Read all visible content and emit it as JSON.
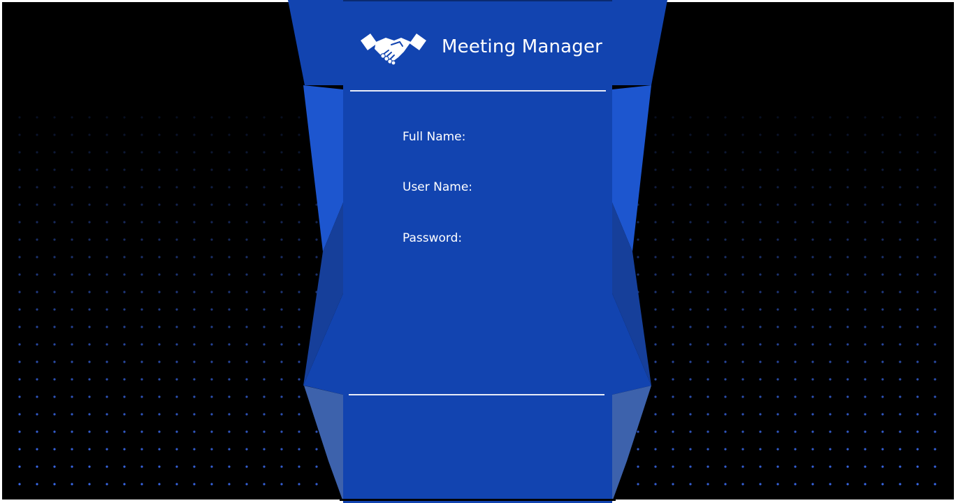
{
  "app": {
    "title": "Meeting Manager",
    "logo_icon": "handshake-icon"
  },
  "form": {
    "full_name_label": "Full Name:",
    "user_name_label": "User Name:",
    "password_label": "Password:",
    "full_name_value": "",
    "user_name_value": "",
    "password_value": ""
  },
  "colors": {
    "background": "#000000",
    "card": "#1244B0",
    "side_panel_light": "#1D56CF",
    "side_panel_dark": "#163F9A",
    "bottom_side_panel": "#3D62AC",
    "dot": "#3C6CF0",
    "text": "#FFFFFF"
  }
}
